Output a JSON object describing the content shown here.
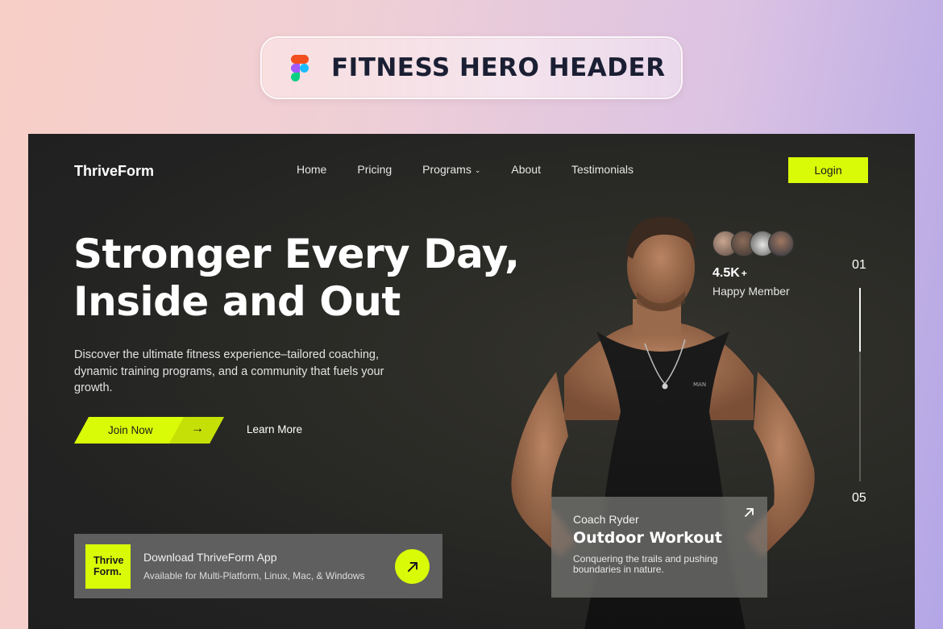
{
  "banner": {
    "title": "FITNESS HERO HEADER",
    "icon": "figma-logo-icon"
  },
  "header": {
    "brand": "ThriveForm",
    "nav": [
      {
        "label": "Home"
      },
      {
        "label": "Pricing"
      },
      {
        "label": "Programs",
        "has_dropdown": true
      },
      {
        "label": "About"
      },
      {
        "label": "Testimonials"
      }
    ],
    "login_label": "Login"
  },
  "hero": {
    "headline_line1": "Stronger Every Day,",
    "headline_line2": "Inside and Out",
    "description": "Discover the ultimate fitness experience–tailored coaching, dynamic training programs, and a community that fuels your growth.",
    "primary_cta": "Join Now",
    "secondary_cta": "Learn More"
  },
  "download": {
    "logo_line1": "Thrive",
    "logo_line2": "Form.",
    "title": "Download ThriveForm App",
    "subtitle": "Available for Multi-Platform, Linux, Mac, & Windows"
  },
  "members": {
    "count": "4.5K",
    "count_suffix": "+",
    "label": "Happy Member",
    "avatar_count": 4
  },
  "slider": {
    "current": "01",
    "total": "05",
    "progress": 0.33
  },
  "coach_card": {
    "coach": "Coach Ryder",
    "title": "Outdoor Workout",
    "description": "Conquering the trails and pushing boundaries in nature."
  },
  "colors": {
    "accent": "#d9fb07",
    "hero_bg": "#222222",
    "banner_text": "#1b1f33"
  }
}
